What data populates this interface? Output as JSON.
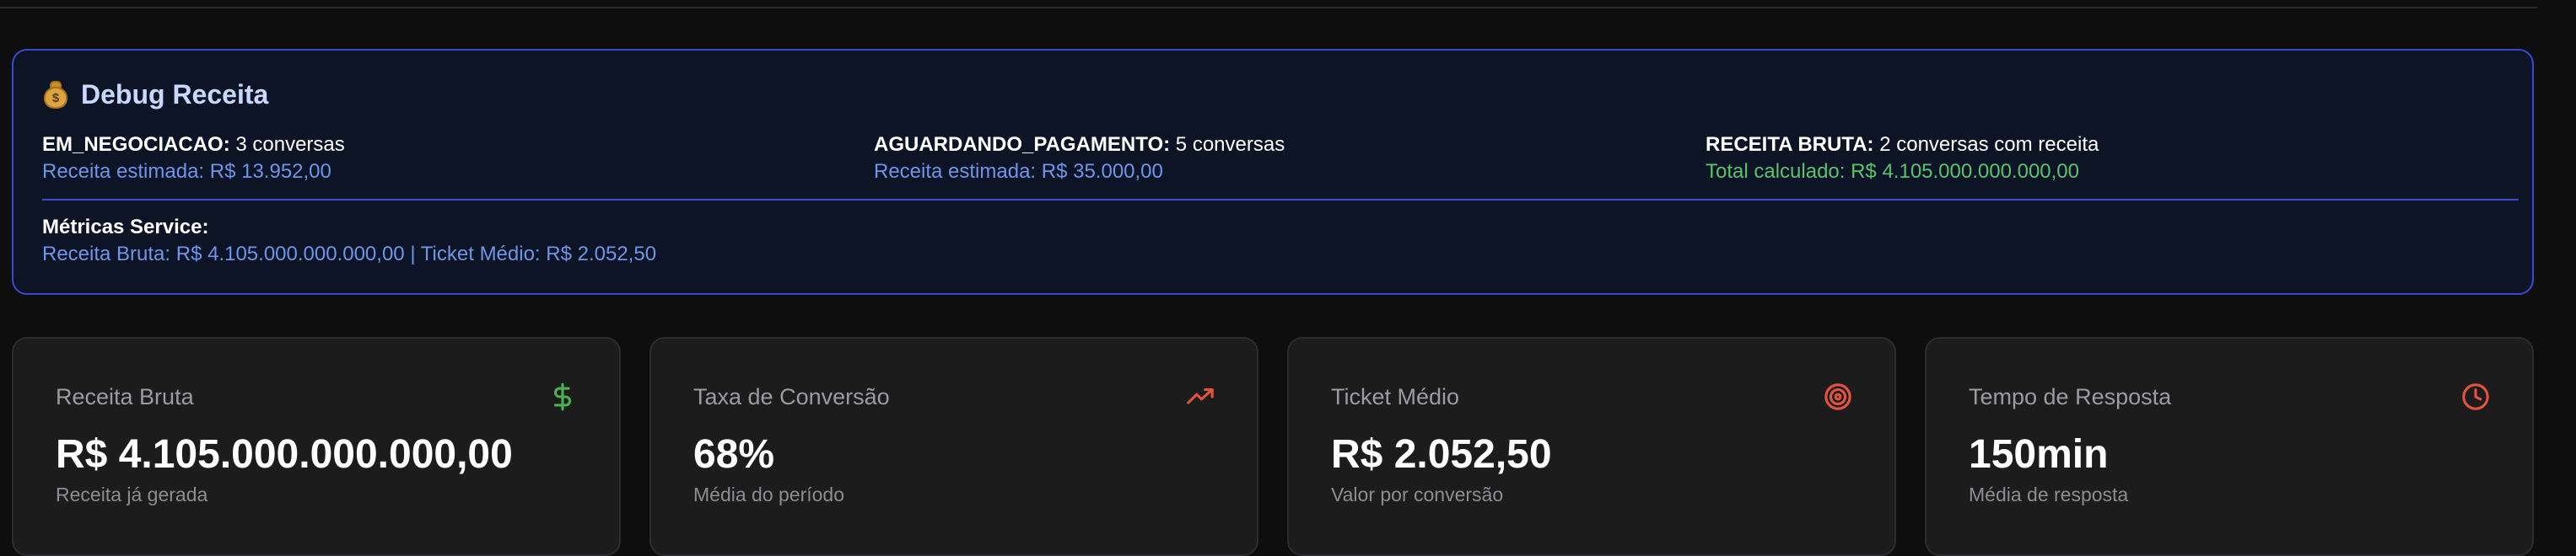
{
  "debug": {
    "title": "Debug Receita",
    "icon": "moneybag-icon",
    "columns": [
      {
        "label": "EM_NEGOCIACAO:",
        "count_text": "3 conversas",
        "detail": "Receita estimada: R$ 13.952,00"
      },
      {
        "label": "AGUARDANDO_PAGAMENTO:",
        "count_text": "5 conversas",
        "detail": "Receita estimada: R$ 35.000,00"
      },
      {
        "label": "RECEITA BRUTA:",
        "count_text": "2 conversas com receita",
        "detail": "Total calculado: R$ 4.105.000.000.000,00"
      }
    ],
    "service": {
      "title": "Métricas Service:",
      "line": "Receita Bruta: R$ 4.105.000.000.000,00 | Ticket Médio: R$ 2.052,50"
    }
  },
  "cards": [
    {
      "label": "Receita Bruta",
      "value": "R$ 4.105.000.000.000,00",
      "sub": "Receita já gerada",
      "icon": "dollar-icon",
      "icon_color": "#4caf50"
    },
    {
      "label": "Taxa de Conversão",
      "value": "68%",
      "sub": "Média do período",
      "icon": "trending-up-icon",
      "icon_color": "#e5533d"
    },
    {
      "label": "Ticket Médio",
      "value": "R$ 2.052,50",
      "sub": "Valor por conversão",
      "icon": "target-icon",
      "icon_color": "#e5533d"
    },
    {
      "label": "Tempo de Resposta",
      "value": "150min",
      "sub": "Média de resposta",
      "icon": "clock-icon",
      "icon_color": "#e5533d"
    }
  ],
  "colors": {
    "panel_border": "#3a4bd0",
    "link_blue": "#6e95e8",
    "total_green": "#58c46c"
  }
}
